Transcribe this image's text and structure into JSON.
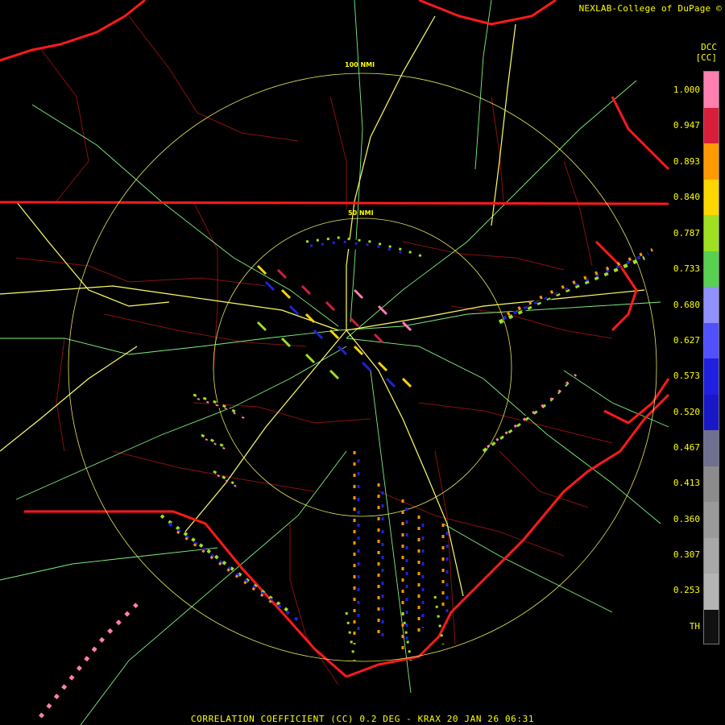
{
  "header": {
    "credit": "NEXLAB-College of DuPage ©"
  },
  "legend": {
    "product_code": "DCC",
    "unit": "[CC]",
    "labels": [
      "1.000",
      "0.947",
      "0.893",
      "0.840",
      "0.787",
      "0.733",
      "0.680",
      "0.627",
      "0.573",
      "0.520",
      "0.467",
      "0.413",
      "0.360",
      "0.307",
      "0.253",
      "TH"
    ],
    "colors": [
      "#ff7fb0",
      "#d81e3a",
      "#ff9a00",
      "#ffd700",
      "#9fe020",
      "#58d050",
      "#9090ff",
      "#5050ff",
      "#2020e0",
      "#1818c8",
      "#6f6f8f",
      "#8c8c8c",
      "#9a9a9a",
      "#a8a8a8",
      "#b4b4b4",
      "#111111"
    ]
  },
  "map": {
    "range_rings": [
      "100 NMI",
      "50 NMI"
    ],
    "colors": {
      "state_lines": "#ff1a1a",
      "county_lines": "#8a1010",
      "roads": "#7ff07f",
      "highways": "#ffff66",
      "range_rings": "#ffff66"
    }
  },
  "footer": {
    "caption": "CORRELATION COEFFICIENT (CC) 0.2 DEG - KRAX 20 JAN 26 06:31"
  }
}
